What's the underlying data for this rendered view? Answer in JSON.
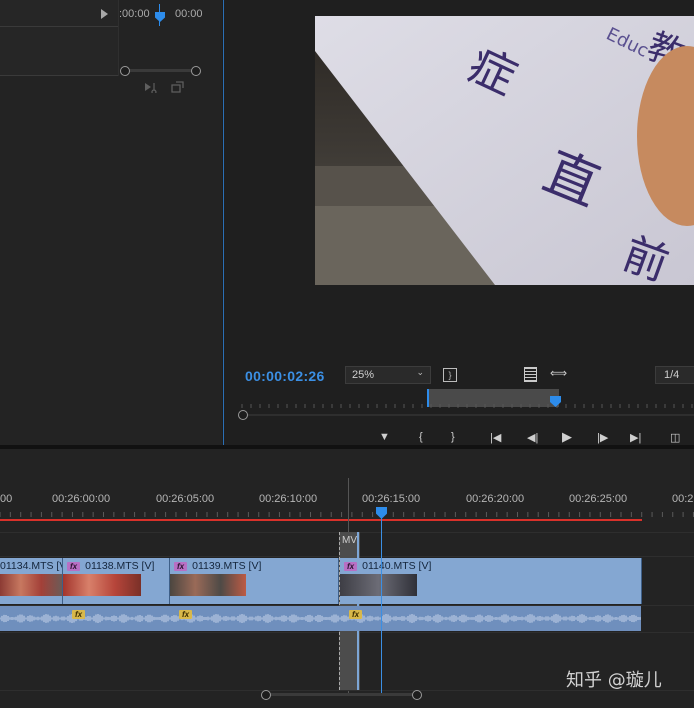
{
  "source_monitor": {
    "timecode_in": ":00:00",
    "timecode_out": "00:00"
  },
  "program_monitor": {
    "timecode": "00:00:02:26",
    "zoom": "25%",
    "resolution": "1/4"
  },
  "timeline": {
    "ruler_labels": [
      "00",
      "00:26:00:00",
      "00:26:05:00",
      "00:26:10:00",
      "00:26:15:00",
      "00:26:20:00",
      "00:26:25:00",
      "00:2"
    ],
    "nested_sequence_label": "MV",
    "clips": [
      {
        "name": "01134.MTS [V"
      },
      {
        "name": "01138.MTS [V]"
      },
      {
        "name": "01139.MTS [V]"
      },
      {
        "name": "01140.MTS [V]"
      }
    ],
    "fx_badge": "fx"
  },
  "watermark": "知乎 @璇儿",
  "colors": {
    "accent_blue": "#2d8ceb",
    "timecode_blue": "#3b8fe4",
    "video_clip": "#84a7d2",
    "audio_clip": "#6f8fbd",
    "render_bar_red": "#d9312a",
    "fx_video": "#b86fc4",
    "fx_audio": "#d8b84a"
  }
}
